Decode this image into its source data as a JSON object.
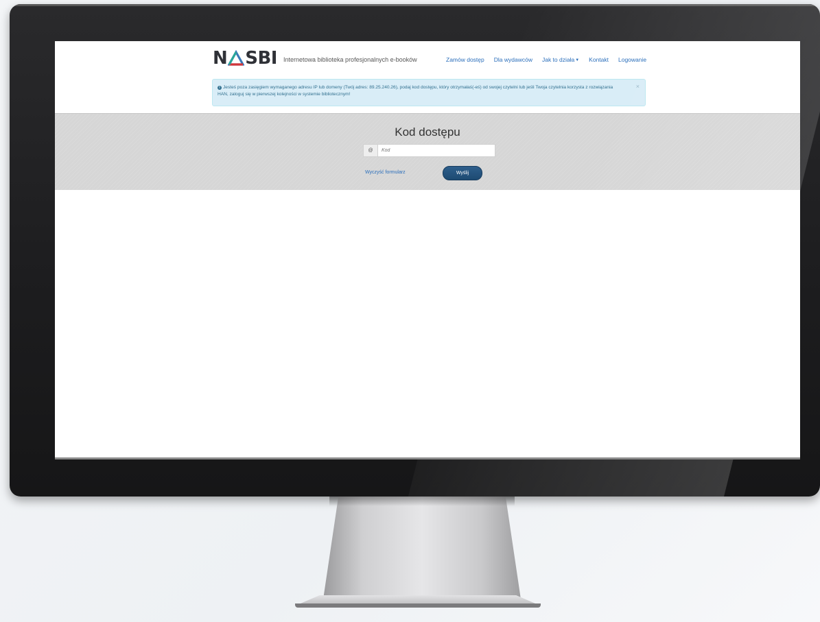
{
  "header": {
    "logo_text_left": "N",
    "logo_text_right": "SBI",
    "tagline": "Internetowa biblioteka profesjonalnych e-booków"
  },
  "nav": {
    "items": [
      {
        "label": "Zamów dostęp"
      },
      {
        "label": "Dla wydawców"
      },
      {
        "label": "Jak to działa"
      },
      {
        "label": "Kontakt"
      },
      {
        "label": "Logowanie"
      }
    ]
  },
  "alert": {
    "text": "Jesteś poza zasięgiem wymaganego adresu IP lub domeny (Twój adres: 89.25.240.26), podaj kod dostępu, który otrzymałaś(-eś) od swojej czytelni lub jeśli Twoja czytelnia korzysta z rozwiązania HAN, zaloguj się w pierwszej kolejności w systemie bibliotecznym!",
    "close": "×",
    "color": "#d9edf7"
  },
  "form": {
    "title": "Kod dostępu",
    "code_placeholder": "Kod",
    "addon_icon": "@",
    "clear_label": "Wyczyść formularz",
    "submit_label": "Wyślij"
  },
  "colors": {
    "link": "#2a6ebb",
    "button": "#1d4a72",
    "band": "#d6d6d6"
  }
}
